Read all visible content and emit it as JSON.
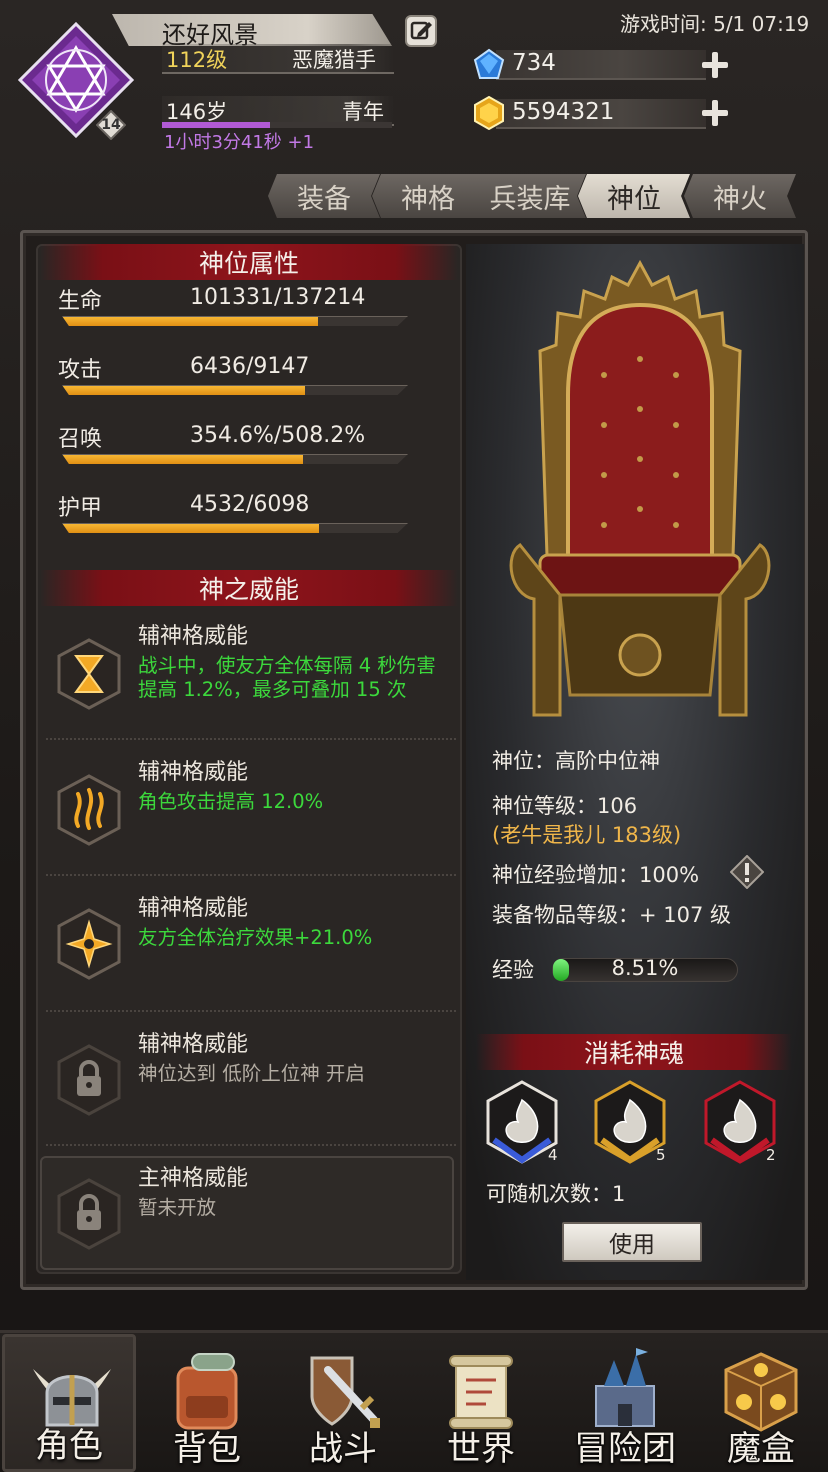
{
  "header": {
    "player_name": "还好风景",
    "level": "112级",
    "class": "恶魔猎手",
    "age": "146岁",
    "stage": "青年",
    "age_timer": "1小时3分41秒 +1",
    "age_progress": 0.47,
    "avatar_badge": "14",
    "game_time": "游戏时间: 5/1 07:19",
    "gems": "734",
    "gold": "5594321"
  },
  "tabs": [
    {
      "label": "装备"
    },
    {
      "label": "神格"
    },
    {
      "label": "兵装库"
    },
    {
      "label": "神位",
      "active": true
    },
    {
      "label": "神火"
    }
  ],
  "attributes": {
    "title": "神位属性",
    "items": [
      {
        "label": "生命",
        "value": "101331/137214",
        "ratio": 0.7385
      },
      {
        "label": "攻击",
        "value": "6436/9147",
        "ratio": 0.7036
      },
      {
        "label": "召唤",
        "value": "354.6%/508.2%",
        "ratio": 0.6978
      },
      {
        "label": "护甲",
        "value": "4532/6098",
        "ratio": 0.7432
      }
    ]
  },
  "powers": {
    "title": "神之威能",
    "items": [
      {
        "title": "辅神格威能",
        "desc": "战斗中，使友方全体每隔 4 秒伤害提高 1.2%，最多可叠加 15 次",
        "icon": "hourglass-icon",
        "locked": false
      },
      {
        "title": "辅神格威能",
        "desc": "角色攻击提高 12.0%",
        "icon": "flame-icon",
        "locked": false
      },
      {
        "title": "辅神格威能",
        "desc": "友方全体治疗效果+21.0%",
        "icon": "heal-star-icon",
        "locked": false
      },
      {
        "title": "辅神格威能",
        "desc": "神位达到 低阶上位神 开启",
        "icon": "lock-icon",
        "locked": true
      },
      {
        "title": "主神格威能",
        "desc": "暂未开放",
        "icon": "lock-icon",
        "locked": true
      }
    ]
  },
  "god_position": {
    "rank": "神位：高阶中位神",
    "level": "神位等级：106",
    "bonus": "(老牛是我儿 183级)",
    "exp_bonus": "神位经验增加：100%",
    "equip_level": "装备物品等级：+ 107 级",
    "exp_label": "经验",
    "exp_value": "8.51%",
    "exp_ratio": 0.0851
  },
  "consume": {
    "title": "消耗神魂",
    "souls": [
      {
        "count": "4",
        "tier": "white",
        "color": "#3a5bd8"
      },
      {
        "count": "5",
        "tier": "gold",
        "color": "#d9a02a"
      },
      {
        "count": "2",
        "tier": "red",
        "color": "#c0182a"
      }
    ],
    "random_times": "可随机次数：1",
    "use_label": "使用"
  },
  "nav": [
    {
      "label": "角色",
      "icon": "helmet-icon",
      "active": true
    },
    {
      "label": "背包",
      "icon": "backpack-icon"
    },
    {
      "label": "战斗",
      "icon": "sword-shield-icon"
    },
    {
      "label": "世界",
      "icon": "scroll-map-icon"
    },
    {
      "label": "冒险团",
      "icon": "castle-icon"
    },
    {
      "label": "魔盒",
      "icon": "magic-box-icon"
    }
  ],
  "colors": {
    "accent_red": "#8e141b",
    "bar_orange": "#f0a424",
    "green_text": "#3cd83c",
    "gold_text": "#f0b64a",
    "purple_timer": "#c279e6"
  }
}
